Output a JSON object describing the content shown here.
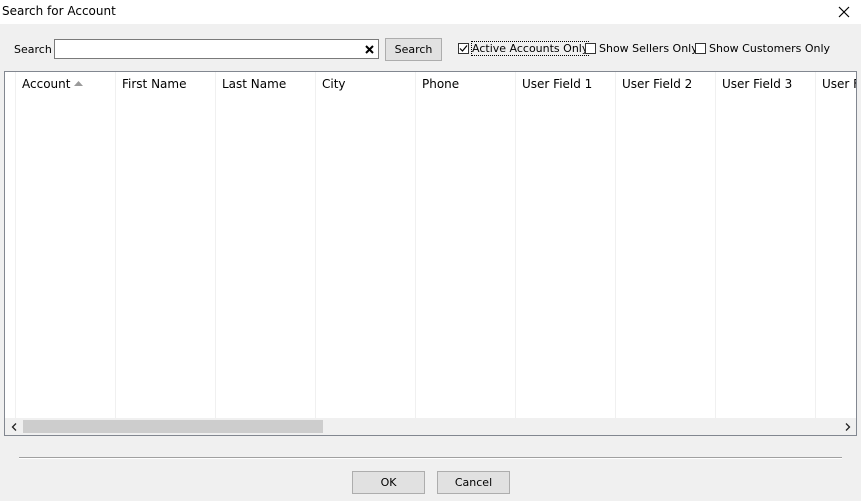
{
  "window": {
    "title": "Search for Account",
    "close_icon": "close-icon"
  },
  "search": {
    "label": "Search",
    "value": "",
    "placeholder": "",
    "clear_icon": "clear-x-icon",
    "button_label": "Search"
  },
  "filters": {
    "active_accounts_only": {
      "label": "Active Accounts Only",
      "checked": true
    },
    "show_sellers_only": {
      "label": "Show Sellers Only",
      "checked": false
    },
    "show_customers_only": {
      "label": "Show Customers Only",
      "checked": false
    }
  },
  "grid": {
    "columns": [
      "Account",
      "First Name",
      "Last Name",
      "City",
      "Phone",
      "User Field 1",
      "User Field 2",
      "User Field 3",
      "User F"
    ],
    "sort_column": "Account",
    "sort_direction": "ascending",
    "rows": []
  },
  "footer": {
    "ok_label": "OK",
    "cancel_label": "Cancel"
  }
}
